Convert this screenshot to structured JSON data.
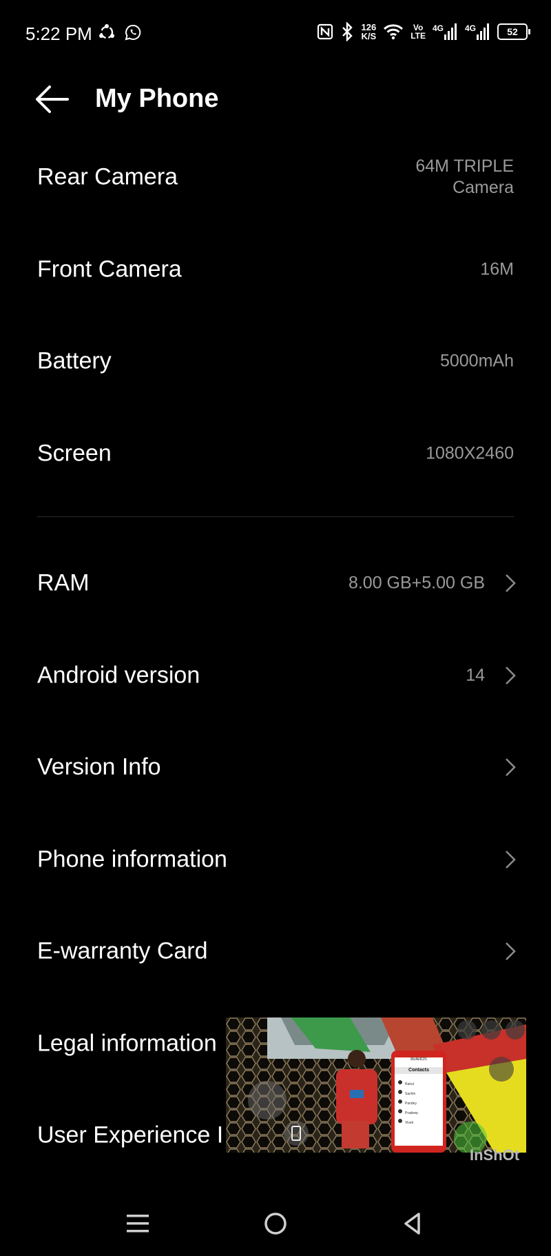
{
  "status_bar": {
    "time": "5:22 PM",
    "net_speed_value": "126",
    "net_speed_unit": "K/S",
    "volte_top": "Vo",
    "volte_bottom": "LTE",
    "sim1_label": "4G",
    "sim2_label": "4G",
    "battery_level": "52",
    "icons": [
      "sync-icon",
      "whatsapp-icon",
      "nfc-icon",
      "bluetooth-icon",
      "wifi-icon",
      "signal-icon"
    ]
  },
  "header": {
    "title": "My Phone",
    "back_icon": "back-arrow-icon"
  },
  "specs": [
    {
      "label": "Rear Camera",
      "value_line1": "64M TRIPLE",
      "value_line2": "Camera"
    },
    {
      "label": "Front Camera",
      "value": "16M"
    },
    {
      "label": "Battery",
      "value": "5000mAh"
    },
    {
      "label": "Screen",
      "value": "1080X2460"
    }
  ],
  "links": [
    {
      "label": "RAM",
      "value": "8.00 GB+5.00 GB"
    },
    {
      "label": "Android version",
      "value": "14"
    },
    {
      "label": "Version Info",
      "value": ""
    },
    {
      "label": "Phone information",
      "value": ""
    },
    {
      "label": "E-warranty Card",
      "value": ""
    },
    {
      "label": "Legal information",
      "value": ""
    },
    {
      "label": "User Experience I",
      "value": ""
    }
  ],
  "pip_overlay": {
    "watermark": "InShOt",
    "phone_title": "BulletOS",
    "phone_header": "Contacts",
    "contacts": [
      "Rahul",
      "Sachin",
      "Pandey",
      "Pradeep",
      "Vivek"
    ]
  },
  "nav_bar": {
    "icons": [
      "menu-icon",
      "home-icon",
      "back-triangle-icon"
    ]
  },
  "colors": {
    "background": "#000000",
    "text_primary": "#ffffff",
    "text_secondary": "#9a9a9a",
    "divider": "#2c2c2c"
  }
}
